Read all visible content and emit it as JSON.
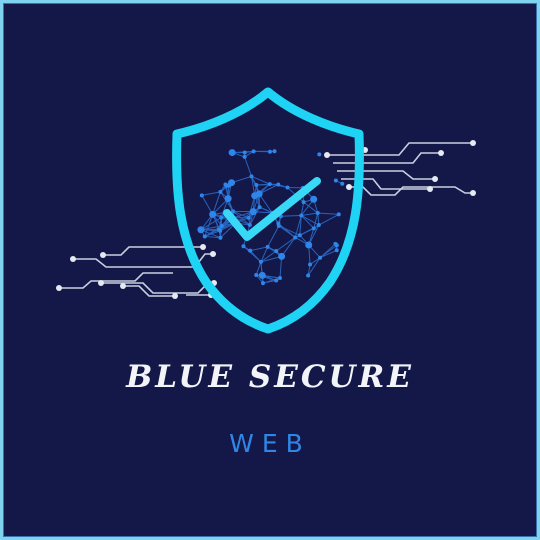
{
  "brand": {
    "title": "BLUE SECURE",
    "subtitle": "WEB"
  },
  "logo": {
    "icon": "shield-check-icon",
    "network_icon": "network-globe-icon",
    "circuit_icon": "circuit-lines-icon"
  },
  "colors": {
    "background": "#131848",
    "frame": "#7fd3ee",
    "shield": "#1fd3f5",
    "network": "#2e7fe0",
    "check": "#37d9f7",
    "circuit": "#c9cfe0",
    "title": "#f2f4f8",
    "subtitle": "#2f86e6"
  }
}
